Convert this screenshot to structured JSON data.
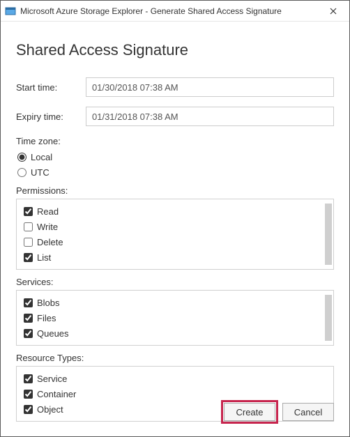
{
  "window": {
    "title": "Microsoft Azure Storage Explorer - Generate Shared Access Signature"
  },
  "heading": "Shared Access Signature",
  "fields": {
    "start": {
      "label": "Start time:",
      "value": "01/30/2018 07:38 AM"
    },
    "expiry": {
      "label": "Expiry time:",
      "value": "01/31/2018 07:38 AM"
    }
  },
  "timezone": {
    "label": "Time zone:",
    "local": "Local",
    "utc": "UTC"
  },
  "permissions": {
    "label": "Permissions:",
    "items": {
      "read": "Read",
      "write": "Write",
      "delete": "Delete",
      "list": "List"
    }
  },
  "services": {
    "label": "Services:",
    "items": {
      "blobs": "Blobs",
      "files": "Files",
      "queues": "Queues"
    }
  },
  "resourceTypes": {
    "label": "Resource Types:",
    "items": {
      "service": "Service",
      "container": "Container",
      "object": "Object"
    }
  },
  "buttons": {
    "create": "Create",
    "cancel": "Cancel"
  }
}
